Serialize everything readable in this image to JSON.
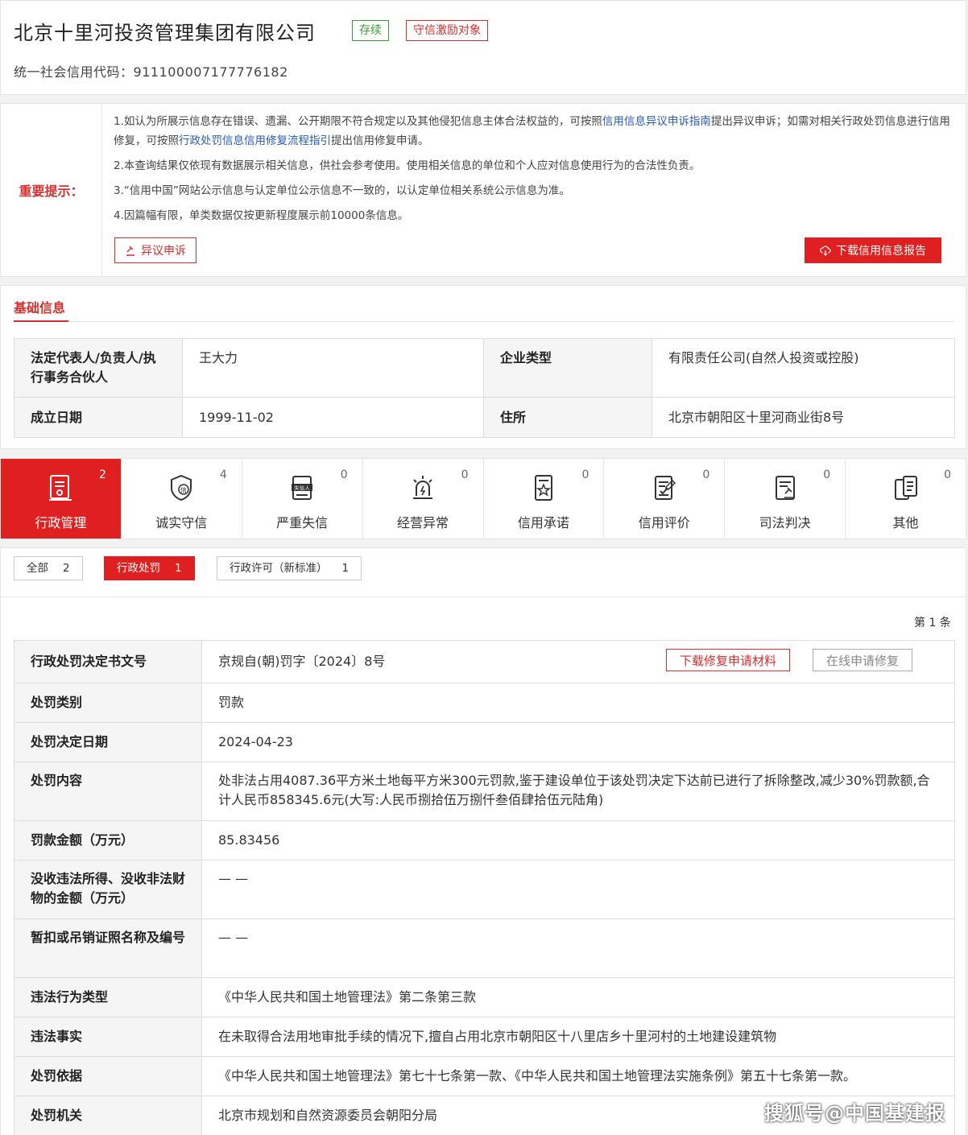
{
  "header": {
    "company_name": "北京十里河投资管理集团有限公司",
    "status_badge": "存续",
    "incentive_badge": "守信激励对象",
    "credit_code_label": "统一社会信用代码：",
    "credit_code": "911100007177776182"
  },
  "notice": {
    "label": "重要提示：",
    "item1_a": "1.如认为所展示信息存在错误、遗漏、公开期限不符合规定以及其他侵犯信息主体合法权益的，可按照",
    "item1_link1": "信用信息异议申诉指南",
    "item1_b": "提出异议申诉；如需对相关行政处罚信息进行信用修复，可按照",
    "item1_link2": "行政处罚信息信用修复流程指引",
    "item1_c": "提出信用修复申请。",
    "item2": "2.本查询结果仅依现有数据展示相关信息，供社会参考使用。使用相关信息的单位和个人应对信息使用行为的合法性负责。",
    "item3": "3.“信用中国”网站公示信息与认定单位公示信息不一致的，以认定单位相关系统公示信息为准。",
    "item4": "4.因篇幅有限，单类数据仅按更新程度展示前10000条信息。",
    "objection_button": "异议申诉",
    "download_button": "下载信用信息报告"
  },
  "basic": {
    "title": "基础信息",
    "legal_rep_label": "法定代表人/负责人/执行事务合伙人",
    "legal_rep": "王大力",
    "type_label": "企业类型",
    "type": "有限责任公司(自然人投资或控股)",
    "founded_label": "成立日期",
    "founded": "1999-11-02",
    "address_label": "住所",
    "address": "北京市朝阳区十里河商业街8号"
  },
  "categories": [
    {
      "label": "行政管理",
      "count": "2",
      "icon": "admin-doc-icon"
    },
    {
      "label": "诚实守信",
      "count": "4",
      "icon": "shield-credit-icon"
    },
    {
      "label": "严重失信",
      "count": "0",
      "icon": "dishonest-person-icon"
    },
    {
      "label": "经营异常",
      "count": "0",
      "icon": "alarm-light-icon"
    },
    {
      "label": "信用承诺",
      "count": "0",
      "icon": "promise-doc-icon"
    },
    {
      "label": "信用评价",
      "count": "0",
      "icon": "evaluation-doc-icon"
    },
    {
      "label": "司法判决",
      "count": "0",
      "icon": "judgment-doc-icon"
    },
    {
      "label": "其他",
      "count": "0",
      "icon": "other-doc-icon"
    }
  ],
  "filters": {
    "all_label": "全部",
    "all_count": "2",
    "penalty_label": "行政处罚",
    "penalty_count": "1",
    "license_label": "行政许可（新标准）",
    "license_count": "1"
  },
  "pager": {
    "text": "第 1 条"
  },
  "penalty": {
    "doc_no_label": "行政处罚决定书文号",
    "doc_no": "京规自(朝)罚字〔2024〕8号",
    "download_repair_button": "下载修复申请材料",
    "online_repair_button": "在线申请修复",
    "category_label": "处罚类别",
    "category": "罚款",
    "date_label": "处罚决定日期",
    "date": "2024-04-23",
    "content_label": "处罚内容",
    "content": "处非法占用4087.36平方米土地每平方米300元罚款,鉴于建设单位于该处罚决定下达前已进行了拆除整改,减少30%罚款额,合计人民币858345.6元(大写:人民币捌拾伍万捌仟叁佰肆拾伍元陆角)",
    "amount_label": "罚款金额（万元）",
    "amount": "85.83456",
    "confiscation_label": "没收违法所得、没收非法财物的金额（万元）",
    "confiscation": "— —",
    "license_revoke_label": "暂扣或吊销证照名称及编号",
    "license_revoke": "— —",
    "violation_type_label": "违法行为类型",
    "violation_type": "《中华人民共和国土地管理法》第二条第三款",
    "facts_label": "违法事实",
    "facts": "在未取得合法用地审批手续的情况下,擅自占用北京市朝阳区十八里店乡十里河村的土地建设建筑物",
    "basis_label": "处罚依据",
    "basis": "《中华人民共和国土地管理法》第七十七条第一款、《中华人民共和国土地管理法实施条例》第五十七条第一款。",
    "authority_label": "处罚机关",
    "authority": "北京市规划和自然资源委员会朝阳分局"
  },
  "watermark": "搜狐号@中国基建报"
}
